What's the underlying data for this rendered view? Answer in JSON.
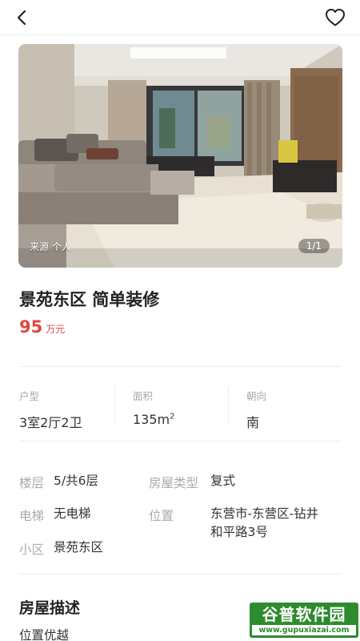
{
  "header": {
    "back_icon": "chevron-left-icon",
    "favorite_icon": "heart-outline-icon"
  },
  "photo": {
    "source_label": "来源 个人",
    "counter": "1/1"
  },
  "listing": {
    "title": "景苑东区 简单装修",
    "price_value": "95",
    "price_unit": "万元",
    "price_color": "#e2463f"
  },
  "stats": {
    "layout_label": "户型",
    "layout_value": "3室2厅2卫",
    "area_label": "面积",
    "area_value": "135m",
    "area_sup": "2",
    "orientation_label": "朝向",
    "orientation_value": "南"
  },
  "details": {
    "floor_label": "楼层",
    "floor_value": "5/共6层",
    "type_label": "房屋类型",
    "type_value": "复式",
    "elevator_label": "电梯",
    "elevator_value": "无电梯",
    "location_label": "位置",
    "location_value_line1": "东营市-东营区-钻井",
    "location_value_line2": "和平路3号",
    "community_label": "小区",
    "community_value": "景苑东区"
  },
  "description": {
    "title": "房屋描述",
    "text": "位置优越"
  },
  "watermark": {
    "name": "谷普软件园",
    "url": "www.gupuxiazai.com"
  }
}
